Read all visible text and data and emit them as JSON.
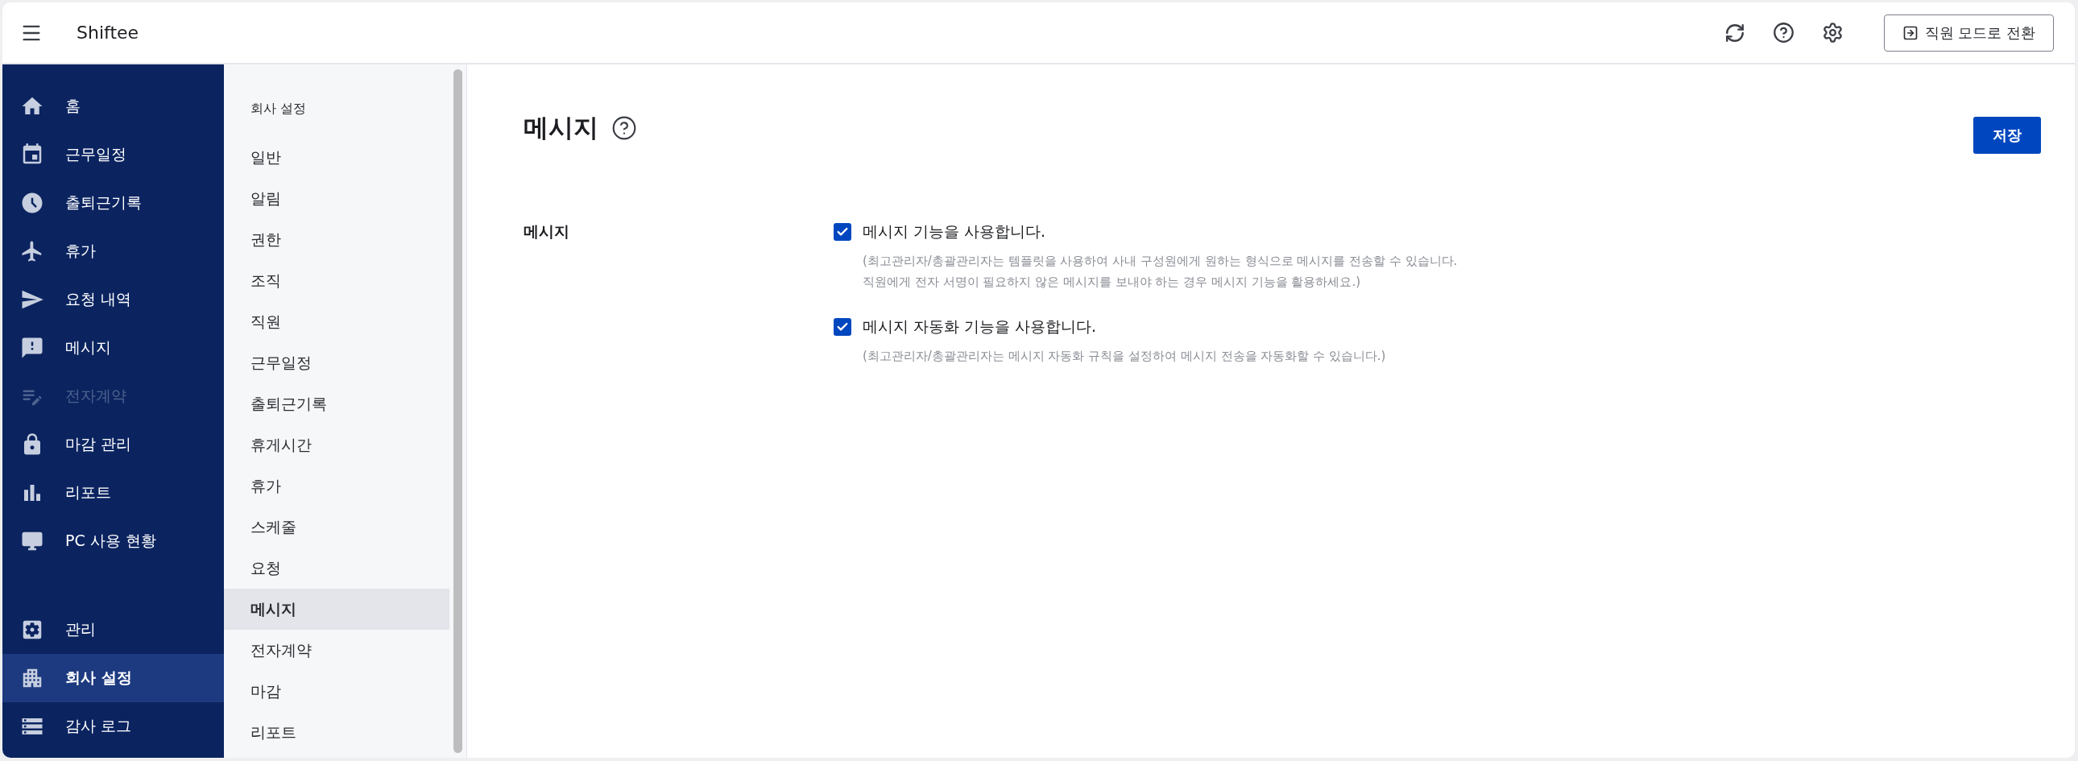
{
  "app": {
    "title": "Shiftee"
  },
  "header": {
    "mode_button": "직원 모드로 전환"
  },
  "nav": {
    "primary": [
      {
        "label": "홈",
        "selected": false,
        "disabled": false
      },
      {
        "label": "근무일정",
        "selected": false,
        "disabled": false
      },
      {
        "label": "출퇴근기록",
        "selected": false,
        "disabled": false
      },
      {
        "label": "휴가",
        "selected": false,
        "disabled": false
      },
      {
        "label": "요청 내역",
        "selected": false,
        "disabled": false
      },
      {
        "label": "메시지",
        "selected": false,
        "disabled": false
      },
      {
        "label": "전자계약",
        "selected": false,
        "disabled": true
      },
      {
        "label": "마감 관리",
        "selected": false,
        "disabled": false
      },
      {
        "label": "리포트",
        "selected": false,
        "disabled": false
      },
      {
        "label": "PC 사용 현황",
        "selected": false,
        "disabled": false
      }
    ],
    "secondary": [
      {
        "label": "관리",
        "selected": false,
        "disabled": false
      },
      {
        "label": "회사 설정",
        "selected": true,
        "disabled": false
      },
      {
        "label": "감사 로그",
        "selected": false,
        "disabled": false
      }
    ]
  },
  "settings_menu": {
    "heading": "회사 설정",
    "items": [
      {
        "label": "일반",
        "selected": false
      },
      {
        "label": "알림",
        "selected": false
      },
      {
        "label": "권한",
        "selected": false
      },
      {
        "label": "조직",
        "selected": false
      },
      {
        "label": "직원",
        "selected": false
      },
      {
        "label": "근무일정",
        "selected": false
      },
      {
        "label": "출퇴근기록",
        "selected": false
      },
      {
        "label": "휴게시간",
        "selected": false
      },
      {
        "label": "휴가",
        "selected": false
      },
      {
        "label": "스케줄",
        "selected": false
      },
      {
        "label": "요청",
        "selected": false
      },
      {
        "label": "메시지",
        "selected": true
      },
      {
        "label": "전자계약",
        "selected": false
      },
      {
        "label": "마감",
        "selected": false
      },
      {
        "label": "리포트",
        "selected": false
      }
    ]
  },
  "page": {
    "title": "메시지",
    "save_button": "저장",
    "section": {
      "label": "메시지",
      "options": [
        {
          "label": "메시지 기능을 사용합니다.",
          "checked": true,
          "description": [
            "(최고관리자/총괄관리자는 템플릿을 사용하여 사내 구성원에게 원하는 형식으로 메시지를 전송할 수 있습니다.",
            "직원에게 전자 서명이 필요하지 않은 메시지를 보내야 하는 경우 메시지 기능을 활용하세요.)"
          ]
        },
        {
          "label": "메시지 자동화 기능을 사용합니다.",
          "checked": true,
          "description": [
            "(최고관리자/총괄관리자는 메시지 자동화 규칙을 설정하여 메시지 전송을 자동화할 수 있습니다.)"
          ]
        }
      ]
    }
  }
}
